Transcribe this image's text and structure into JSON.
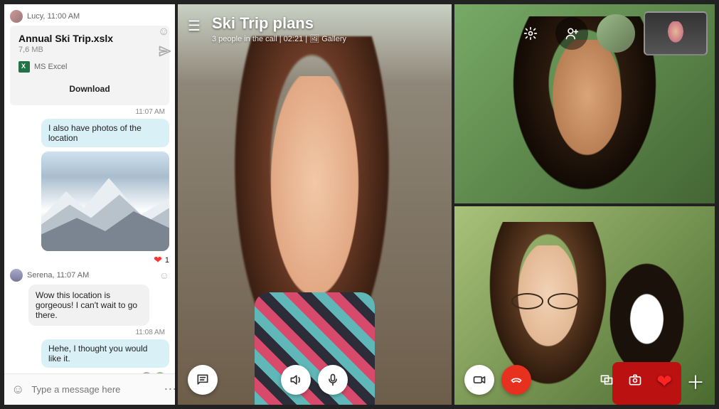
{
  "chat": {
    "senders": {
      "lucy": "Lucy, 11:00 AM",
      "serena": "Serena, 11:07 AM"
    },
    "file": {
      "name": "Annual Ski Trip.xslx",
      "size": "7,6 MB",
      "type_label": "MS Excel",
      "download_label": "Download"
    },
    "timestamps": {
      "t1": "11:07 AM",
      "t2": "11:08 AM"
    },
    "msg_out_1": "I also have photos of the location",
    "msg_in_1": "Wow this location is gorgeous! I can't wait to go there.",
    "msg_out_2": "Hehe, I thought you would like it.",
    "reaction_count": "1",
    "composer_placeholder": "Type a message here"
  },
  "call": {
    "title": "Ski Trip plans",
    "subtitle_people": "3 people in the call",
    "subtitle_duration": "02:21",
    "subtitle_view": "Gallery"
  }
}
